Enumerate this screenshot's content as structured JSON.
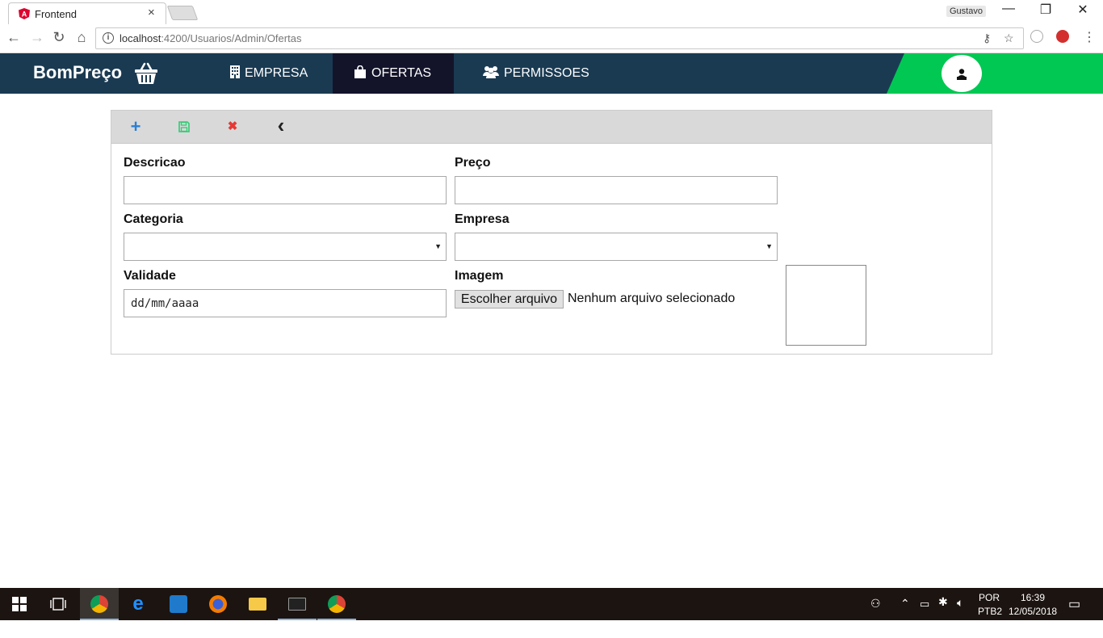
{
  "browser": {
    "tab_title": "Frontend",
    "tab_close": "×",
    "profile": "Gustavo",
    "url_host": "localhost",
    "url_path": ":4200/Usuarios/Admin/Ofertas",
    "win_min": "—",
    "win_restore": "❐",
    "win_close": "✕"
  },
  "navbar": {
    "brand": "BomPreço",
    "items": [
      {
        "label": "EMPRESA",
        "icon": "building-icon",
        "active": false
      },
      {
        "label": "OFERTAS",
        "icon": "shopping-bag-icon",
        "active": true
      },
      {
        "label": "PERMISSOES",
        "icon": "users-icon",
        "active": false
      }
    ]
  },
  "toolbar": {
    "add": "+",
    "cancel": "✖",
    "back": "‹",
    "colors": {
      "add": "#2a7fd4",
      "save": "#2ecc71",
      "cancel": "#e53935",
      "back": "#222222"
    }
  },
  "form": {
    "descricao_label": "Descricao",
    "preco_label": "Preço",
    "categoria_label": "Categoria",
    "empresa_label": "Empresa",
    "validade_label": "Validade",
    "validade_placeholder": "dd/mm/aaaa",
    "imagem_label": "Imagem",
    "file_button": "Escolher arquivo",
    "file_status": "Nenhum arquivo selecionado"
  },
  "taskbar": {
    "lang_top": "POR",
    "lang_bottom": "PTB2",
    "time": "16:39",
    "date": "12/05/2018"
  }
}
